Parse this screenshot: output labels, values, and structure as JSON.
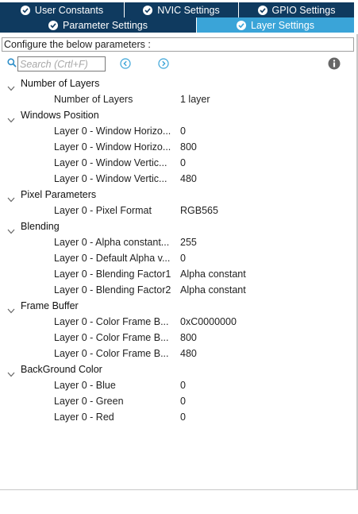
{
  "tabs_top": [
    {
      "label": "User Constants"
    },
    {
      "label": "NVIC Settings"
    },
    {
      "label": "GPIO Settings"
    }
  ],
  "tabs_bottom": [
    {
      "label": "Parameter Settings",
      "active": false
    },
    {
      "label": "Layer Settings",
      "active": true
    }
  ],
  "config_header": "Configure the below parameters :",
  "search": {
    "placeholder": "Search (Crtl+F)"
  },
  "icons": {
    "search": "search-icon",
    "prev": "circle-chevron-left-icon",
    "next": "circle-chevron-right-icon",
    "info": "info-icon",
    "check": "check-circle-icon",
    "expand": "chevron-down-icon"
  },
  "colors": {
    "tab_dark": "#0f3a5f",
    "tab_active": "#3aa4d8",
    "accent": "#3aa4d8",
    "info_icon": "#666666"
  },
  "groups": [
    {
      "label": "Number of Layers",
      "params": [
        {
          "label": "Number of Layers",
          "value": "1 layer"
        }
      ]
    },
    {
      "label": "Windows Position",
      "params": [
        {
          "label": "Layer 0 - Window Horizo...",
          "value": "0"
        },
        {
          "label": "Layer 0 - Window Horizo...",
          "value": "800"
        },
        {
          "label": "Layer 0 - Window Vertic...",
          "value": "0"
        },
        {
          "label": "Layer 0 - Window Vertic...",
          "value": "480"
        }
      ]
    },
    {
      "label": "Pixel Parameters",
      "params": [
        {
          "label": "Layer 0 - Pixel Format",
          "value": "RGB565"
        }
      ]
    },
    {
      "label": "Blending",
      "params": [
        {
          "label": "Layer 0 - Alpha constant...",
          "value": "255"
        },
        {
          "label": "Layer 0 - Default Alpha v...",
          "value": "0"
        },
        {
          "label": "Layer 0 - Blending Factor1",
          "value": "Alpha constant"
        },
        {
          "label": "Layer 0 - Blending Factor2",
          "value": "Alpha constant"
        }
      ]
    },
    {
      "label": "Frame Buffer",
      "params": [
        {
          "label": "Layer 0 - Color Frame B...",
          "value": "0xC0000000"
        },
        {
          "label": "Layer 0 - Color Frame B...",
          "value": "800"
        },
        {
          "label": "Layer 0 - Color Frame B...",
          "value": "480"
        }
      ]
    },
    {
      "label": "BackGround Color",
      "params": [
        {
          "label": "Layer 0 - Blue",
          "value": "0"
        },
        {
          "label": "Layer 0 - Green",
          "value": "0"
        },
        {
          "label": "Layer 0 - Red",
          "value": "0"
        }
      ]
    }
  ]
}
